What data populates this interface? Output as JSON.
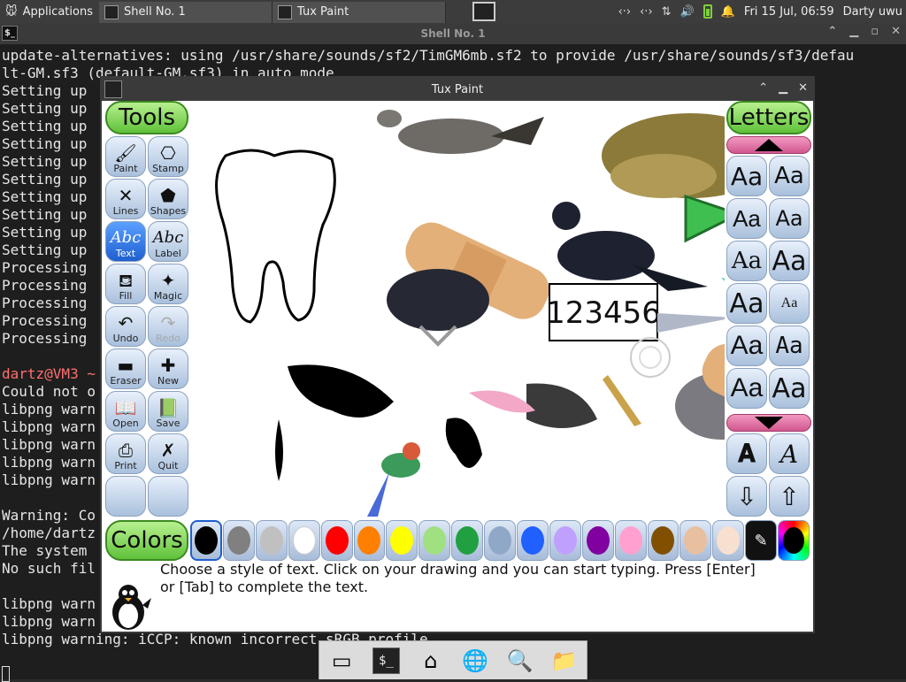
{
  "panel": {
    "applications": "Applications",
    "taskbar": [
      {
        "label": "Shell No. 1",
        "icon": "terminal-icon"
      },
      {
        "label": "Tux Paint",
        "icon": "tuxpaint-icon"
      }
    ],
    "clock": "Fri 15 Jul, 06:59",
    "user": "Darty uwu"
  },
  "terminal": {
    "title": "Shell No. 1",
    "lines": [
      "update-alternatives: using /usr/share/sounds/sf2/TimGM6mb.sf2 to provide /usr/share/sounds/sf3/defau",
      "lt-GM.sf3 (default-GM.sf3) in auto mode",
      "Setting up",
      "Setting up",
      "Setting up",
      "Setting up",
      "Setting up",
      "Setting up",
      "Setting up",
      "Setting up",
      "Setting up",
      "Setting up",
      "Processing",
      "Processing",
      "Processing",
      "Processing",
      "Processing",
      "",
      "dartz@VM3 ~",
      "Could not o",
      "libpng warn",
      "libpng warn",
      "libpng warn",
      "libpng warn",
      "libpng warn",
      "",
      "Warning: Co",
      "/home/dartz",
      "The system",
      "No such fil",
      "",
      "libpng warn",
      "libpng warn",
      "libpng warning: iCCP: known incorrect sRGB profile",
      ""
    ]
  },
  "tuxpaint": {
    "title": "Tux Paint",
    "tools_header": "Tools",
    "letters_header": "Letters",
    "colors_header": "Colors",
    "tools": [
      {
        "label": "Paint",
        "icon": "brush-icon",
        "glyph": "🖌"
      },
      {
        "label": "Stamp",
        "icon": "stamp-icon",
        "glyph": "⎔"
      },
      {
        "label": "Lines",
        "icon": "lines-icon",
        "glyph": "✕"
      },
      {
        "label": "Shapes",
        "icon": "pentagon-icon",
        "glyph": "⬟"
      },
      {
        "label": "Text",
        "icon": "text-abc-icon",
        "glyph": "Abc"
      },
      {
        "label": "Label",
        "icon": "label-abc-icon",
        "glyph": "Abc"
      },
      {
        "label": "Fill",
        "icon": "bucket-icon",
        "glyph": "⛾"
      },
      {
        "label": "Magic",
        "icon": "wand-icon",
        "glyph": "✦"
      },
      {
        "label": "Undo",
        "icon": "undo-icon",
        "glyph": "↶"
      },
      {
        "label": "Redo",
        "icon": "redo-icon",
        "glyph": "↷"
      },
      {
        "label": "Eraser",
        "icon": "eraser-icon",
        "glyph": "▬"
      },
      {
        "label": "New",
        "icon": "new-page-icon",
        "glyph": "✚"
      },
      {
        "label": "Open",
        "icon": "open-book-icon",
        "glyph": "📖"
      },
      {
        "label": "Save",
        "icon": "save-book-icon",
        "glyph": "📗"
      },
      {
        "label": "Print",
        "icon": "printer-icon",
        "glyph": "⎙"
      },
      {
        "label": "Quit",
        "icon": "quit-icon",
        "glyph": "✗"
      }
    ],
    "selected_tool": "Text",
    "font_samples": [
      "Aa",
      "Aa",
      "Aa",
      "Aa",
      "Aa",
      "Aa",
      "Aa",
      "Aa",
      "Aa",
      "Aa",
      "Aa",
      "Aa"
    ],
    "size_buttons": [
      "AA",
      "AA"
    ],
    "colors": [
      "#000000",
      "#808080",
      "#c0c0c0",
      "#ffffff",
      "#ff0000",
      "#ff8000",
      "#ffff00",
      "#a0e080",
      "#20a040",
      "#8fa8c8",
      "#2060ff",
      "#c0a0ff",
      "#8000a0",
      "#ffa0d0",
      "#805000",
      "#e8c0a0",
      "#f8e0d0"
    ],
    "canvas_text": "123456",
    "message": "Choose a style of text. Click on your drawing and you can start typing. Press [Enter] or [Tab] to complete the text."
  },
  "dock": [
    "show-desktop-icon",
    "terminal-icon",
    "home-folder-icon",
    "web-browser-icon",
    "search-icon",
    "folder-icon"
  ]
}
